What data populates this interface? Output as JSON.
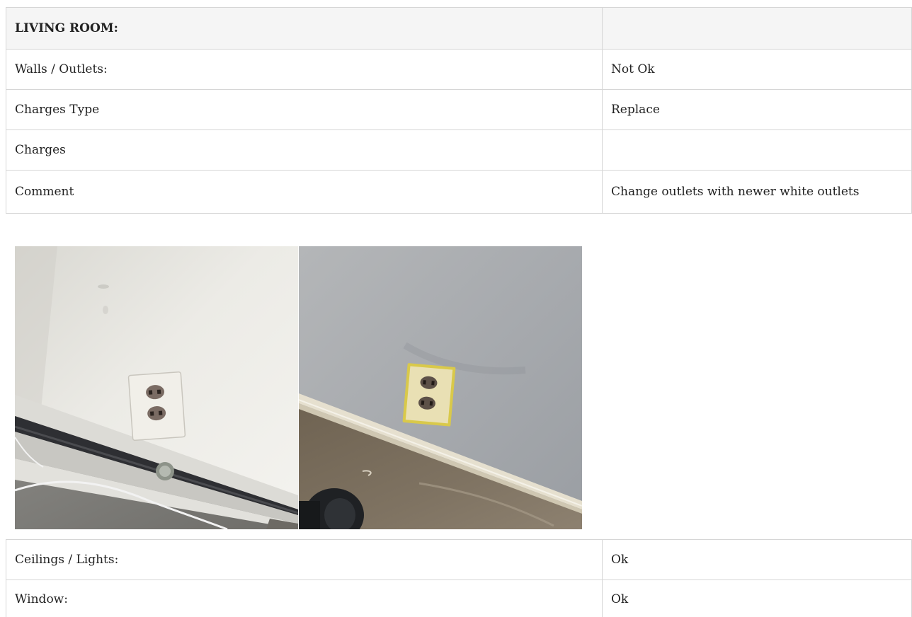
{
  "section": {
    "title": "LIVING ROOM:",
    "value": ""
  },
  "rows_top": [
    {
      "label": "Walls / Outlets:",
      "value": "Not Ok"
    },
    {
      "label": "Charges Type",
      "value": "Replace"
    },
    {
      "label": "Charges",
      "value": ""
    },
    {
      "label": "Comment",
      "value": "Change outlets with newer white outlets"
    }
  ],
  "photos": [
    {
      "subject": "wall outlet near baseboard heater"
    },
    {
      "subject": "wall outlet with yellowed cover plate"
    }
  ],
  "rows_bottom": [
    {
      "label": "Ceilings / Lights:",
      "value": "Ok"
    },
    {
      "label": "Window:",
      "value": "Ok"
    }
  ]
}
